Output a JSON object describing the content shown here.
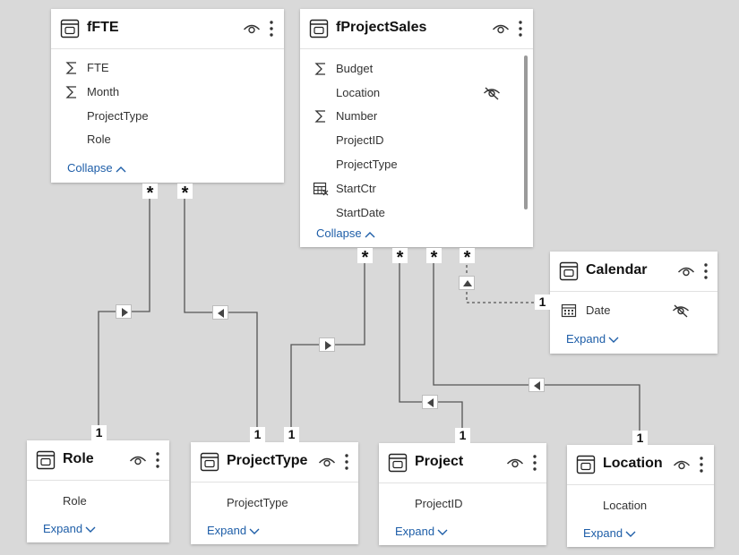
{
  "tables": {
    "fFTE": {
      "title": "fFTE",
      "fields": [
        "FTE",
        "Month",
        "ProjectType",
        "Role"
      ],
      "toggle": "Collapse"
    },
    "fProjectSales": {
      "title": "fProjectSales",
      "fields": [
        "Budget",
        "Location",
        "Number",
        "ProjectID",
        "ProjectType",
        "StartCtr",
        "StartDate"
      ],
      "toggle": "Collapse"
    },
    "Calendar": {
      "title": "Calendar",
      "fields": [
        "Date"
      ],
      "toggle": "Expand"
    },
    "Role": {
      "title": "Role",
      "fields": [
        "Role"
      ],
      "toggle": "Expand"
    },
    "ProjectType": {
      "title": "ProjectType",
      "fields": [
        "ProjectType"
      ],
      "toggle": "Expand"
    },
    "Project": {
      "title": "Project",
      "fields": [
        "ProjectID"
      ],
      "toggle": "Expand"
    },
    "Location": {
      "title": "Location",
      "fields": [
        "Location"
      ],
      "toggle": "Expand"
    }
  },
  "cardinality": {
    "many": "*",
    "one": "1"
  },
  "icons": {
    "table": "table-icon",
    "visibility": "eye-icon",
    "more": "more-options-icon",
    "sum": "sigma-icon",
    "calculated": "calc-table-icon",
    "calendar": "calendar-icon",
    "hidden": "eye-slash-icon",
    "expand": "chevron-down-icon",
    "collapse": "chevron-up-icon",
    "filter_direction": "triangle-arrow-icon"
  },
  "colors": {
    "canvas": "#d9d9d9",
    "card": "#ffffff",
    "link": "#1e5ea8",
    "line": "#555555"
  }
}
